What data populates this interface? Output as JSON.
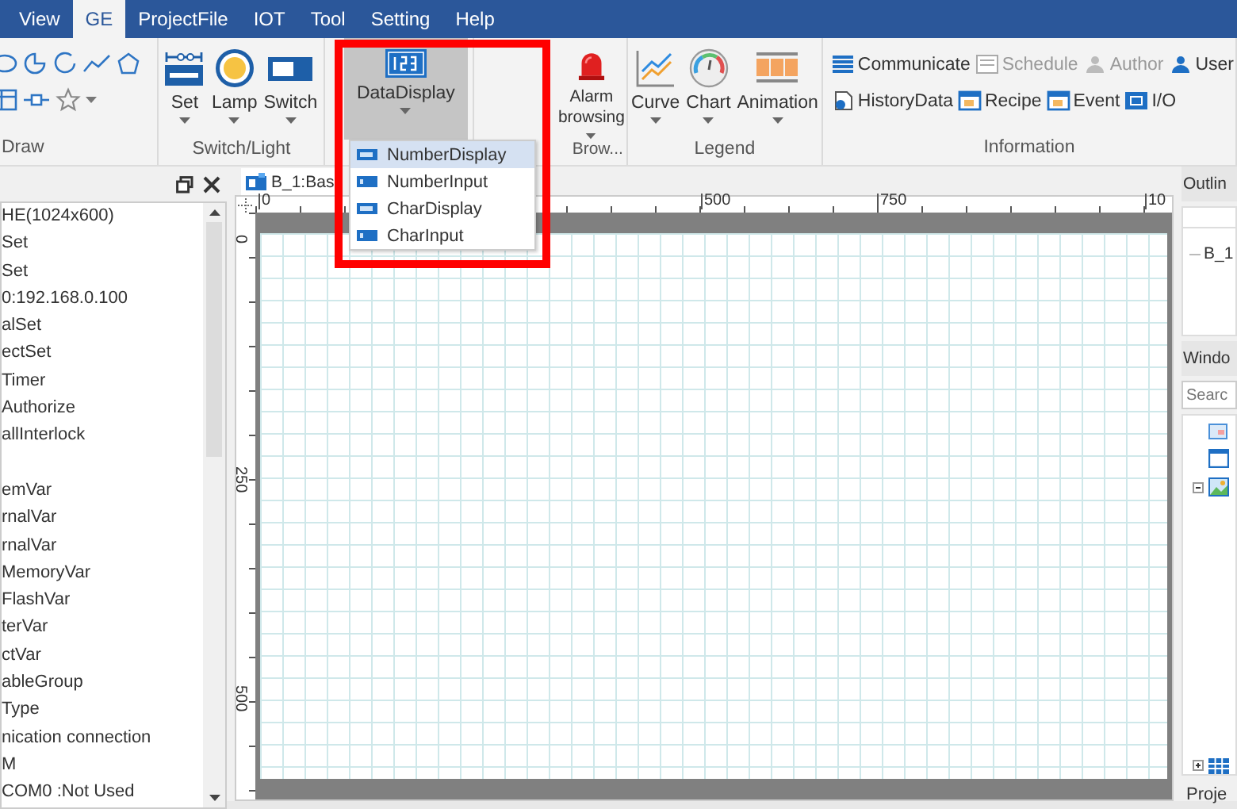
{
  "menu_tabs": [
    {
      "label": "View",
      "selected": false
    },
    {
      "label": "GE",
      "selected": true
    },
    {
      "label": "ProjectFile",
      "selected": false
    },
    {
      "label": "IOT",
      "selected": false
    },
    {
      "label": "Tool",
      "selected": false
    },
    {
      "label": "Setting",
      "selected": false
    },
    {
      "label": "Help",
      "selected": false
    }
  ],
  "ribbon": {
    "draw": {
      "label": "Draw"
    },
    "switch_light": {
      "label": "Switch/Light",
      "buttons": [
        {
          "label": "Set",
          "dropdown": true
        },
        {
          "label": "Lamp",
          "dropdown": true
        },
        {
          "label": "Switch",
          "dropdown": true
        }
      ]
    },
    "data_display": {
      "button": {
        "label": "DataDisplay",
        "pressed": true,
        "dropdown": true
      }
    },
    "alarm": {
      "label": "Brow...",
      "button": {
        "label": "Alarm browsing",
        "dropdown": true
      }
    },
    "legend": {
      "label": "Legend",
      "buttons": [
        {
          "label": "Curve",
          "dropdown": true
        },
        {
          "label": "Chart",
          "dropdown": true
        },
        {
          "label": "Animation",
          "dropdown": true
        }
      ]
    },
    "information": {
      "label": "Information",
      "rows": [
        [
          {
            "label": "Communicate",
            "disabled": false
          },
          {
            "label": "Schedule",
            "disabled": true
          },
          {
            "label": "Author",
            "disabled": true
          },
          {
            "label": "User",
            "disabled": false
          }
        ],
        [
          {
            "label": "HistoryData",
            "disabled": false
          },
          {
            "label": "Recipe",
            "disabled": false
          },
          {
            "label": "Event",
            "disabled": false
          },
          {
            "label": "I/O",
            "disabled": false
          }
        ]
      ]
    }
  },
  "dropdown_menu": {
    "items": [
      {
        "label": "NumberDisplay",
        "selected": true
      },
      {
        "label": "NumberInput",
        "selected": false
      },
      {
        "label": "CharDisplay",
        "selected": false
      },
      {
        "label": "CharInput",
        "selected": false
      }
    ]
  },
  "left_panel": {
    "items": [
      {
        "text": "HE(1024x600)",
        "gap_before": false
      },
      {
        "text": "Set",
        "gap_before": false
      },
      {
        "text": "Set",
        "gap_before": false
      },
      {
        "text": "0:192.168.0.100",
        "gap_before": false
      },
      {
        "text": "alSet",
        "gap_before": false
      },
      {
        "text": "ectSet",
        "gap_before": false
      },
      {
        "text": "Timer",
        "gap_before": false
      },
      {
        "text": "Authorize",
        "gap_before": false
      },
      {
        "text": "allInterlock",
        "gap_before": false
      },
      {
        "text": "emVar",
        "gap_before": true
      },
      {
        "text": "rnalVar",
        "gap_before": false
      },
      {
        "text": "rnalVar",
        "gap_before": false
      },
      {
        "text": "MemoryVar",
        "gap_before": false
      },
      {
        "text": "FlashVar",
        "gap_before": false
      },
      {
        "text": "terVar",
        "gap_before": false
      },
      {
        "text": "ctVar",
        "gap_before": false
      },
      {
        "text": "ableGroup",
        "gap_before": false
      },
      {
        "text": "Type",
        "gap_before": false
      },
      {
        "text": "nication connection",
        "gap_before": false
      },
      {
        "text": "M",
        "gap_before": false
      },
      {
        "text": "COM0 :Not Used",
        "gap_before": false
      }
    ]
  },
  "document_tab": {
    "label": "B_1:Bas"
  },
  "canvas": {
    "top_ruler": [
      "0",
      "500",
      "750",
      "10"
    ],
    "left_ruler": [
      "0",
      "250",
      "500"
    ]
  },
  "outline_panel": {
    "title": "Outlin",
    "tree_item": "B_1"
  },
  "window_panel": {
    "title": "Windo",
    "search": {
      "placeholder": "Searc"
    }
  },
  "bottom_tab": {
    "label": "Proje"
  }
}
